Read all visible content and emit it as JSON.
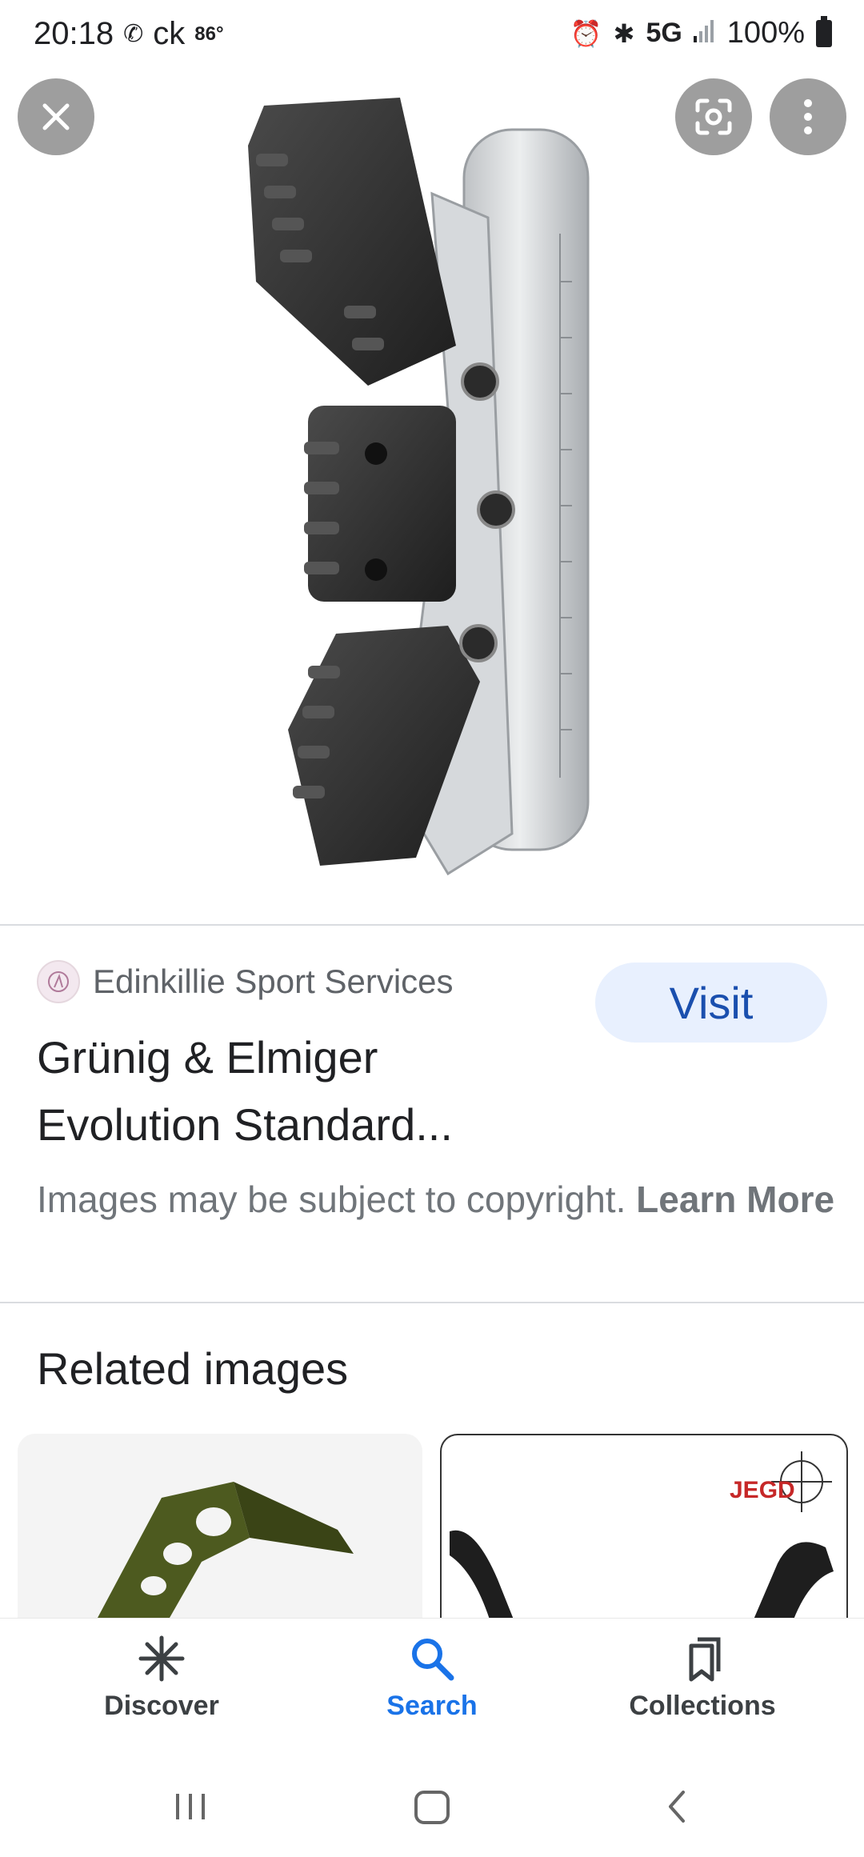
{
  "status_bar": {
    "time": "20:18",
    "carrier": "ck",
    "temperature": "86°",
    "network": "5G",
    "battery": "100%"
  },
  "result": {
    "source_name": "Edinkillie Sport Services",
    "visit_label": "Visit",
    "title": "Grünig & Elmiger Evolution Standard...",
    "copyright_text": "Images may be subject to copyright.",
    "learn_more_label": "Learn More"
  },
  "related": {
    "title": "Related images",
    "thumb2_logo": "JEGD"
  },
  "bottom_nav": {
    "items": [
      {
        "label": "Discover",
        "icon": "asterisk-icon"
      },
      {
        "label": "Search",
        "icon": "search-icon"
      },
      {
        "label": "Collections",
        "icon": "collections-icon"
      }
    ],
    "active": "Search"
  },
  "colors": {
    "accent": "#1a73e8",
    "visit_bg": "#e8f0fe",
    "visit_text": "#1a4fae"
  }
}
